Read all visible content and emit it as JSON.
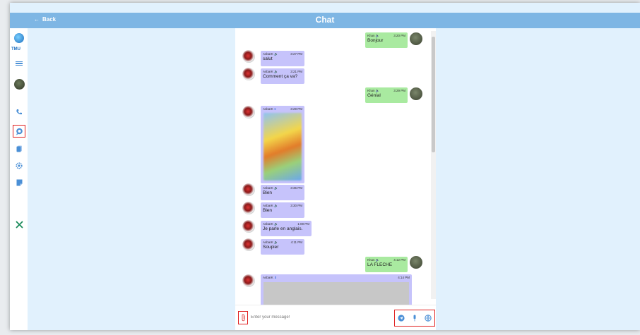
{
  "header": {
    "back_label": "Back",
    "title": "Chat"
  },
  "sidebar": {
    "logo_text": "TMU"
  },
  "messages": [
    {
      "dir": "sent",
      "sender": "Khan",
      "time": "3:20 PM",
      "text": "Bonjour"
    },
    {
      "dir": "recv",
      "sender": "AsbarK",
      "time": "3:27 PM",
      "text": "salut"
    },
    {
      "dir": "recv",
      "sender": "AsbarK",
      "time": "3:21 PM",
      "text": "Comment ça va?"
    },
    {
      "dir": "sent",
      "sender": "Khan",
      "time": "3:29 PM",
      "text": "Génial"
    },
    {
      "dir": "recv",
      "sender": "AsbarK",
      "time": "3:29 PM",
      "text": ""
    },
    {
      "dir": "recv",
      "sender": "AsbarK",
      "time": "3:35 PM",
      "text": "Bien"
    },
    {
      "dir": "recv",
      "sender": "AsbarK",
      "time": "3:30 PM",
      "text": "Bien"
    },
    {
      "dir": "recv",
      "sender": "AsbarK",
      "time": "1:09 PM",
      "text": "Je parle en anglais."
    },
    {
      "dir": "recv",
      "sender": "AsbarK",
      "time": "4:11 PM",
      "text": "Soupier"
    },
    {
      "dir": "sent",
      "sender": "Khan",
      "time": "4:12 PM",
      "text": "LA FLECHE"
    },
    {
      "dir": "recv",
      "sender": "AsbarK",
      "time": "4:14 PM",
      "text": ""
    }
  ],
  "composer": {
    "placeholder": "Enter your message!"
  }
}
